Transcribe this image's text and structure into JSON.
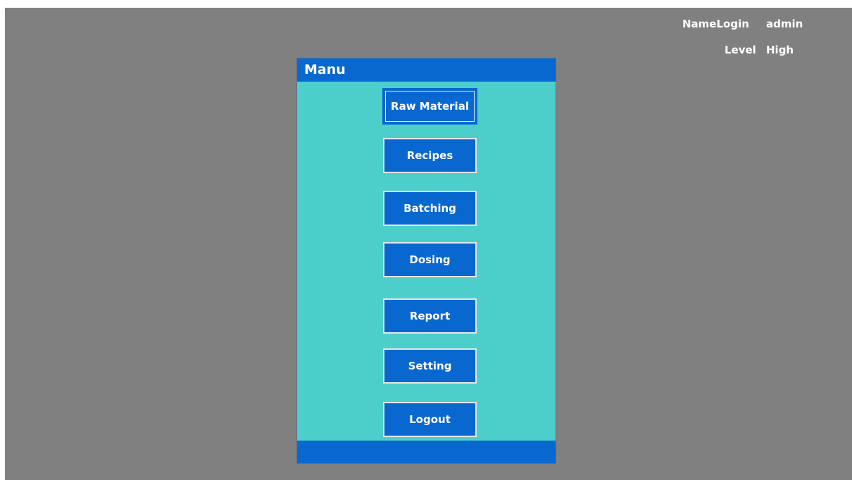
{
  "header": {
    "name_label": "NameLogin",
    "name_value": "admin",
    "level_label": "Level",
    "level_value": "High"
  },
  "menu": {
    "title": "Manu",
    "buttons": [
      {
        "label": "Raw Material"
      },
      {
        "label": "Recipes"
      },
      {
        "label": "Batching"
      },
      {
        "label": "Dosing"
      },
      {
        "label": "Report"
      },
      {
        "label": "Setting"
      },
      {
        "label": "Logout"
      }
    ]
  },
  "colors": {
    "background": "#808080",
    "panel": "#4ccfcb",
    "accent": "#0968cf",
    "text": "#ffffff"
  }
}
